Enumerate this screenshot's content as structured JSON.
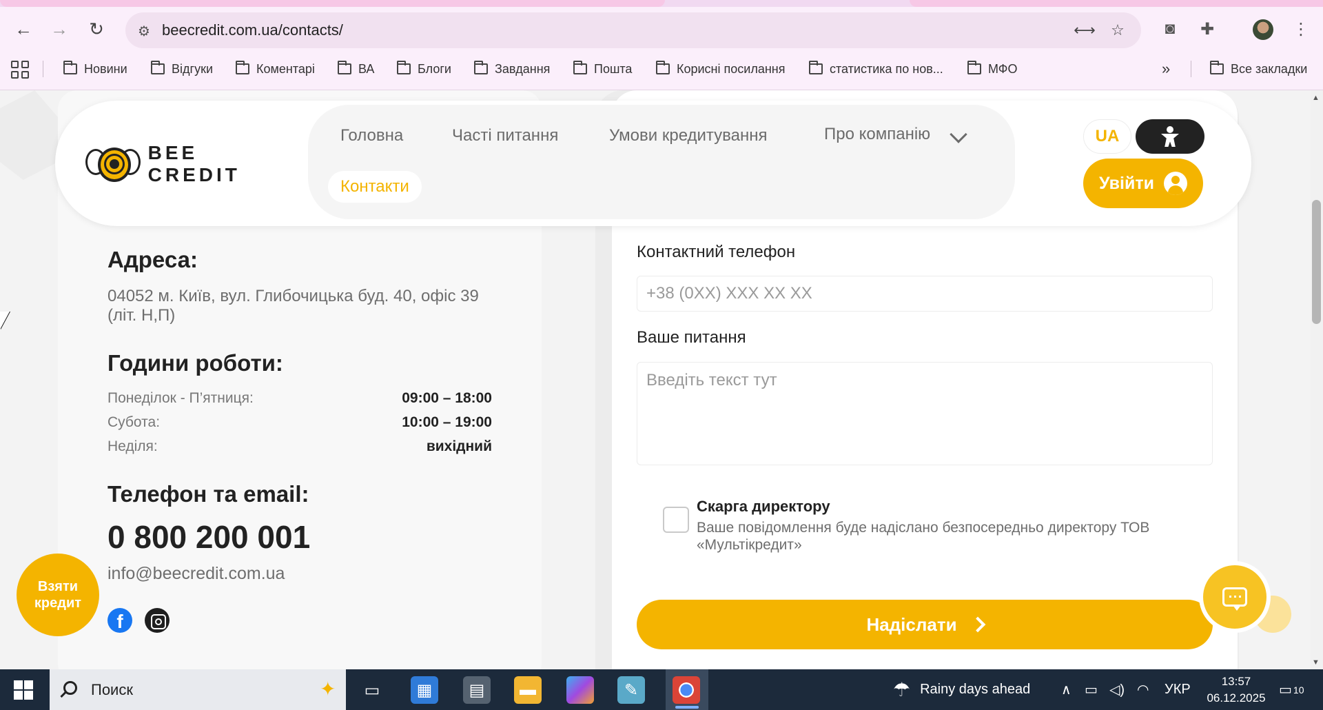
{
  "browser": {
    "url": "beecredit.com.ua/contacts/",
    "bookmarks": [
      "Новини",
      "Відгуки",
      "Коментарі",
      "ВА",
      "Блоги",
      "Завдання",
      "Пошта",
      "Корисні посилання",
      "статистика по нов...",
      "МФО"
    ],
    "all_bookmarks": "Все закладки"
  },
  "site": {
    "logo": "BEE CREDIT",
    "nav": [
      "Головна",
      "Часті питання",
      "Умови кредитування",
      "Про компанію"
    ],
    "nav_active": "Контакти",
    "lang": "UA",
    "login": "Увійти"
  },
  "contacts": {
    "address_title": "Адреса:",
    "address": "04052 м. Київ, вул. Глибочицька буд. 40, офіс 39 (літ. Н,П)",
    "hours_title": "Години роботи:",
    "hours": [
      {
        "day": "Понеділок - П’ятниця:",
        "time": "09:00 – 18:00"
      },
      {
        "day": "Субота:",
        "time": "10:00 – 19:00"
      },
      {
        "day": "Неділя:",
        "time": "вихідний"
      }
    ],
    "phone_title": "Телефон та email:",
    "phone": "0 800 200 001",
    "email": "info@beecredit.com.ua",
    "take_credit": "Взяти кредит"
  },
  "form": {
    "phone_label": "Контактний телефон",
    "phone_placeholder": "+38 (0XX) XXX XX XX",
    "question_label": "Ваше питання",
    "question_placeholder": "Введіть текст тут",
    "complaint_title": "Скарга директору",
    "complaint_desc": "Ваше повідомлення буде надіслано безпосередньо директору ТОВ «Мультікредит»",
    "submit": "Надіслати"
  },
  "taskbar": {
    "search": "Поиск",
    "weather": "Rainy days ahead",
    "lang": "УКР",
    "time": "13:57",
    "date": "06.12.2025",
    "notifications": "10"
  }
}
